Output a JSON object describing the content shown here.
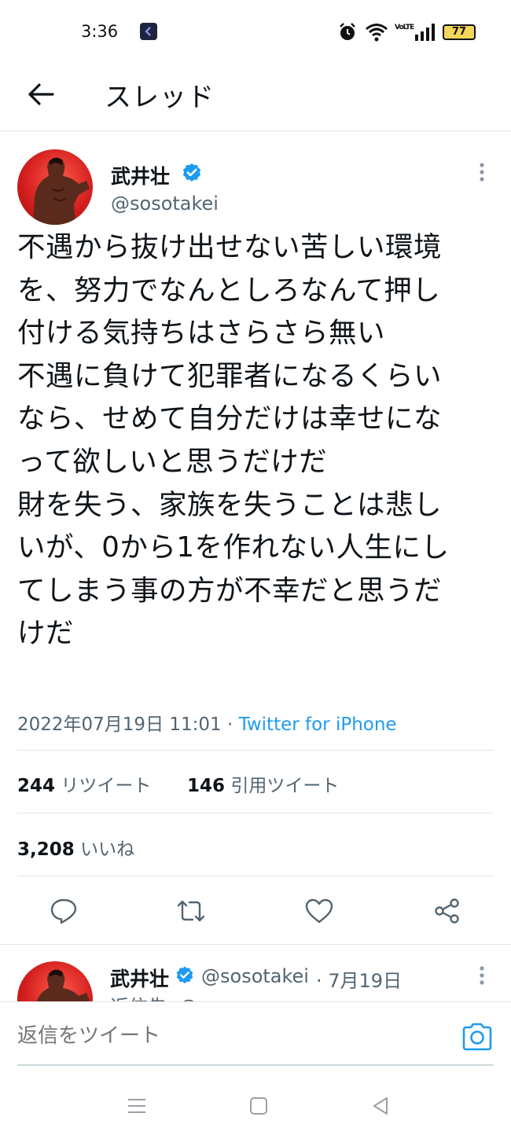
{
  "status_bar": {
    "time": "3:36",
    "battery_level": "77",
    "network": "VoLTE"
  },
  "header": {
    "title": "スレッド"
  },
  "tweet": {
    "author_name": "武井壮",
    "handle": "@sosotakei",
    "text": "不遇から抜け出せない苦しい環境\nを、努力でなんとしろなんて押し\n付ける気持ちはさらさら無い\n不遇に負けて犯罪者になるくらい\nなら、せめて自分だけは幸せにな\nって欲しいと思うだけだ\n財を失う、家族を失うことは悲し\nいが、0から1を作れない人生にし\nてしまう事の方が不幸だと思うだ\nけだ",
    "timestamp": "2022年07月19日 11:01",
    "separator": " · ",
    "source": "Twitter for iPhone",
    "retweets_count": "244",
    "retweets_label": "リツイート",
    "quotes_count": "146",
    "quotes_label": "引用ツイート",
    "likes_count": "3,208",
    "likes_label": "いいね"
  },
  "reply_preview": {
    "author_name": "武井壮",
    "handle": "@sosotakei",
    "date": "· 7月19日",
    "sub_text": "返信先: @"
  },
  "reply_box": {
    "placeholder": "返信をツイート"
  },
  "colors": {
    "accent": "#1d9bf0",
    "text": "#0f1419",
    "secondary": "#536471",
    "avatar_bg": "#d41f1f"
  },
  "icons": [
    "arrow-left-icon",
    "verified-badge-icon",
    "more-vertical-icon",
    "reply-icon",
    "retweet-icon",
    "heart-icon",
    "share-icon",
    "camera-icon",
    "nav-menu-icon",
    "nav-home-icon",
    "nav-back-icon",
    "alarm-icon",
    "wifi-icon",
    "signal-icon",
    "battery-icon"
  ]
}
